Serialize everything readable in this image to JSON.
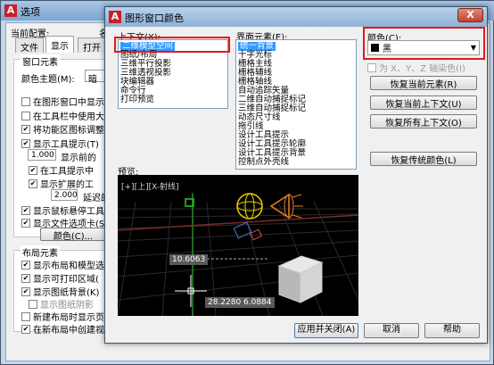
{
  "options_window": {
    "title": "选项",
    "profile_label": "当前配置:",
    "drawing_label_partial": "名",
    "tabs": [
      "文件",
      "显示",
      "打开"
    ],
    "window_elements_title": "窗口元素",
    "color_scheme_label": "颜色主题(M):",
    "color_scheme_value": "暗",
    "checkboxes_top": [
      {
        "label": "在图形窗口中显示",
        "checked": false
      },
      {
        "label": "在工具栏中使用大",
        "checked": false
      },
      {
        "label": "将功能区图标调整",
        "checked": true
      },
      {
        "label": "显示工具提示(T)",
        "checked": true
      }
    ],
    "tooltip_delay_value": "1.000",
    "tooltip_delay_label": "显示前的",
    "checkboxes_mid": [
      {
        "label": "在工具提示中",
        "checked": true
      },
      {
        "label": "显示扩展的工",
        "checked": true
      }
    ],
    "ext_delay_value": "2.000",
    "ext_delay_label": "延迟的",
    "checkboxes_lower": [
      {
        "label": "显示鼠标悬停工具",
        "checked": true
      },
      {
        "label": "显示文件选项卡(S)",
        "checked": true
      }
    ],
    "colors_button": "颜色(C)...",
    "layout_title": "布局元素",
    "layout_checkboxes": [
      {
        "label": "显示布局和模型选",
        "checked": true
      },
      {
        "label": "显示可打印区域(",
        "checked": true
      },
      {
        "label": "显示图纸背景(K)",
        "checked": true
      },
      {
        "label": "显示图纸阴影",
        "checked": false
      },
      {
        "label": "新建布局时显示页",
        "checked": false
      },
      {
        "label": "在新布局中创建视",
        "checked": true
      }
    ]
  },
  "dialog": {
    "title": "图形窗口颜色",
    "close_label": "X",
    "context_label": "上下文(X):",
    "context_items": [
      "二维模型空间",
      "图纸/布局",
      "三维平行投影",
      "三维透视投影",
      "块编辑器",
      "命令行",
      "打印预览"
    ],
    "context_selected": 0,
    "element_label": "界面元素(E):",
    "element_items": [
      "统一背景",
      "十字光标",
      "栅格主线",
      "栅格辅线",
      "栅格轴线",
      "自动追踪矢量",
      "二维自动捕捉标记",
      "三维自动捕捉标记",
      "动态尺寸线",
      "拖引线",
      "设计工具提示",
      "设计工具提示轮廓",
      "设计工具提示背景",
      "控制点外壳线"
    ],
    "element_selected": 0,
    "color_label": "颜色(C):",
    "color_value": "黑",
    "tint_label": "为 X、Y、Z 轴染色(I)",
    "buttons": {
      "restore_current_element": "恢复当前元素(R)",
      "restore_current_context": "恢复当前上下文(U)",
      "restore_all_contexts": "恢复所有上下文(O)",
      "restore_classic_colors": "恢复传统颜色(L)",
      "apply_close": "应用并关闭(A)",
      "cancel": "取消",
      "help": "帮助"
    },
    "preview_label": "预览:",
    "preview_viewport_label": "[+][上][X-射线]",
    "preview_dim_1": "10.6063",
    "preview_dim_2": "28.2280",
    "preview_dim_3": "6.0884"
  },
  "colors": {
    "red_highlight": "#e0191e",
    "selection": "#3399ff",
    "preview_bg": "#000000"
  }
}
